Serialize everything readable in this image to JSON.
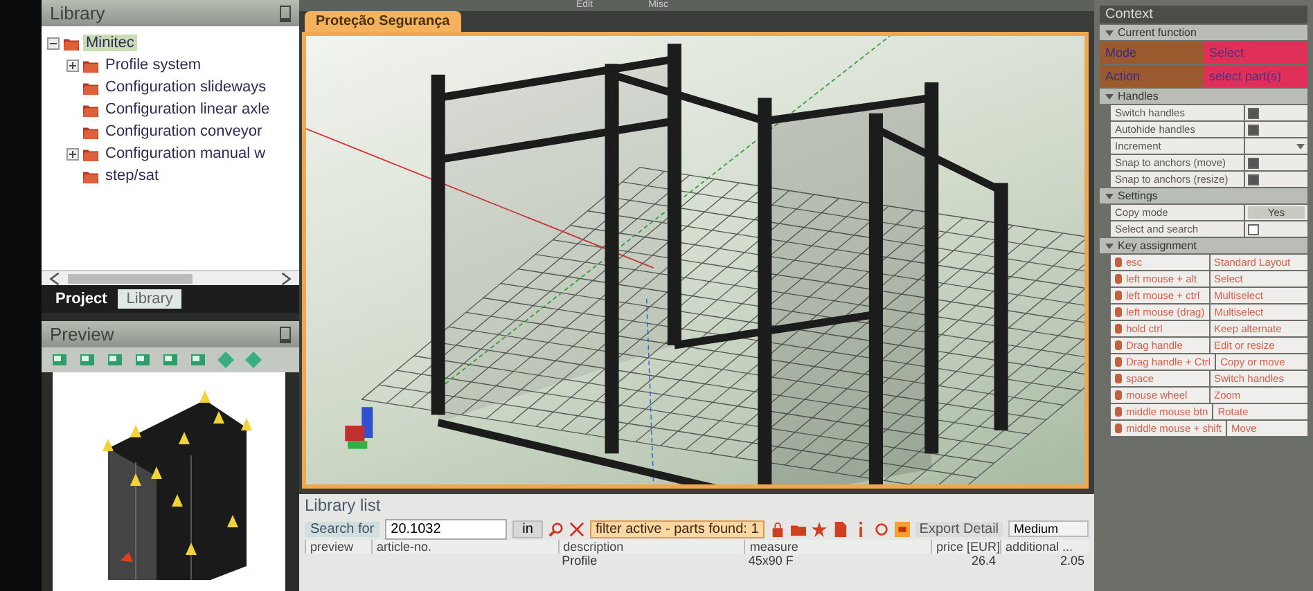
{
  "menu_tabs": [
    {
      "label": "Edit"
    },
    {
      "label": "Misc"
    }
  ],
  "library": {
    "title": "Library",
    "tree": [
      {
        "label": "Minitec",
        "selected": true,
        "expanded": true,
        "children": [
          {
            "label": "Profile system",
            "selected": false,
            "expanded": false
          },
          {
            "label": "Configuration slideways",
            "selected": false
          },
          {
            "label": "Configuration linear axle",
            "selected": false
          },
          {
            "label": "Configuration conveyor",
            "selected": false
          },
          {
            "label": "Configuration manual w",
            "selected": false,
            "expanded": false
          },
          {
            "label": "step/sat",
            "selected": false
          }
        ]
      }
    ]
  },
  "panel_tabs": [
    {
      "label": "Project",
      "selected": true
    },
    {
      "label": "Library",
      "selected": false
    }
  ],
  "preview": {
    "title": "Preview"
  },
  "document_tabs": [
    {
      "label": "Proteção Segurança",
      "selected": true
    }
  ],
  "library_list": {
    "title": "Library list",
    "search_label": "Search for",
    "search_value": "20.1032",
    "scope": "in",
    "filter_badge": "filter active - parts found: 1",
    "export_label": "Export Detail",
    "export_value": "Medium",
    "columns": [
      "preview",
      "article-no.",
      "description",
      "measure",
      "price [EUR]",
      "additional ..."
    ],
    "rows": [
      {
        "description": "Profile",
        "measure": "45x90 F",
        "price": "26.4",
        "additional": "2.05"
      }
    ]
  },
  "context": {
    "title": "Context",
    "sections": [
      {
        "title": "Current function",
        "kind": "colored",
        "rows": [
          {
            "label": "Mode",
            "value": "Select"
          },
          {
            "label": "Action",
            "value": "select part(s)"
          }
        ]
      },
      {
        "title": "Handles",
        "kind": "props",
        "rows": [
          {
            "kind": "check",
            "label": "Switch handles",
            "checked": true
          },
          {
            "kind": "check",
            "label": "Autohide handles",
            "checked": true
          },
          {
            "kind": "dropdown",
            "label": "Increment"
          },
          {
            "kind": "check",
            "label": "Snap to anchors (move)",
            "checked": true
          },
          {
            "kind": "check",
            "label": "Snap to anchors (resize)",
            "checked": true
          }
        ]
      },
      {
        "title": "Settings",
        "kind": "props",
        "rows": [
          {
            "kind": "button",
            "label": "Copy mode",
            "value": "Yes"
          },
          {
            "kind": "check",
            "label": "Select and search",
            "checked": false
          }
        ]
      },
      {
        "title": "Key assignment",
        "kind": "keys",
        "rows": [
          {
            "key": "esc",
            "action": "Standard Layout"
          },
          {
            "key": "left mouse + alt",
            "action": "Select"
          },
          {
            "key": "left mouse + ctrl",
            "action": "Multiselect"
          },
          {
            "key": "left mouse (drag)",
            "action": "Multiselect"
          },
          {
            "key": "hold ctrl",
            "action": "Keep alternate"
          },
          {
            "key": "Drag handle",
            "action": "Edit or resize"
          },
          {
            "key": "Drag handle + Ctrl",
            "action": "Copy or move"
          },
          {
            "key": "space",
            "action": "Switch handles"
          },
          {
            "key": "mouse wheel",
            "action": "Zoom"
          },
          {
            "key": "middle mouse btn",
            "action": "Rotate"
          },
          {
            "key": "middle mouse + shift",
            "action": "Move"
          }
        ]
      }
    ]
  }
}
